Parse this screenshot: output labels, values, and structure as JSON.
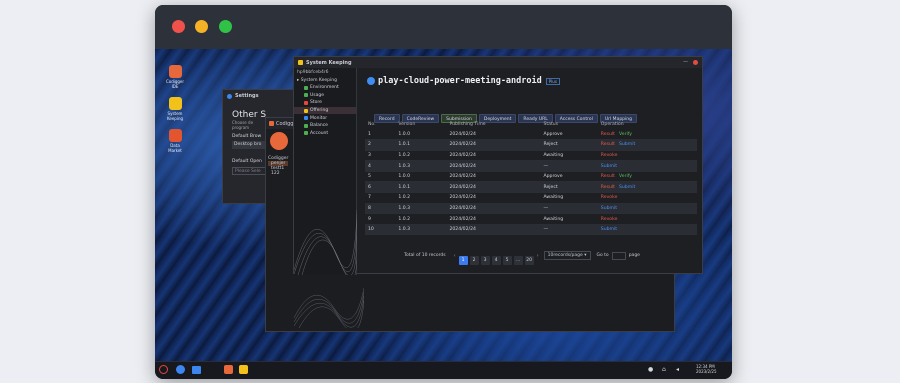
{
  "desktop": {
    "icons": [
      {
        "label": "Codigger IDE",
        "color": "#e7683a"
      },
      {
        "label": "System Keeping",
        "color": "#f3c21a"
      },
      {
        "label": "Data Market",
        "color": "#e2552f"
      }
    ]
  },
  "settings_window": {
    "title": "Settings",
    "heading": "Other S",
    "sub": "Choose de",
    "sub2": "program",
    "default_browser_label": "Default Brow",
    "browser_value": "Desktop bro",
    "default_open_label": "Default Open",
    "open_placeholder": "Please Sele"
  },
  "ide_window": {
    "title": "Codigg",
    "tree": [
      "Codigger",
      "penjer",
      "testt1",
      "122"
    ]
  },
  "system_keeping": {
    "title": "System Keeping",
    "user": "hp9bbfceb4r6",
    "root": "System Keeping",
    "menu": [
      "Environment",
      "Usage",
      "Store",
      "Offering",
      "Monitor",
      "Balance",
      "Account"
    ],
    "selected": "Offering"
  },
  "project": {
    "name": "play-cloud-power-meeting-android",
    "badge": "Plus",
    "tabs": [
      "Record",
      "CodeReview",
      "Submission",
      "Deployment",
      "Ready URL",
      "Access Control",
      "Url Mapping"
    ],
    "active_tab": "Submission"
  },
  "table": {
    "headers": [
      "No.",
      "Version",
      "Publishing Time",
      "Status",
      "Operation"
    ],
    "rows": [
      {
        "no": "1",
        "version": "1.0.0",
        "time": "2024/02/24",
        "status": "Approve",
        "ops": [
          {
            "t": "Result",
            "c": "r"
          },
          {
            "t": "Verify",
            "c": "g"
          }
        ]
      },
      {
        "no": "2",
        "version": "1.0.1",
        "time": "2024/02/24",
        "status": "Reject",
        "ops": [
          {
            "t": "Result",
            "c": "r"
          },
          {
            "t": "Submit",
            "c": "b"
          }
        ]
      },
      {
        "no": "3",
        "version": "1.0.2",
        "time": "2024/02/24",
        "status": "Awaiting",
        "ops": [
          {
            "t": "Revoke",
            "c": "r"
          }
        ]
      },
      {
        "no": "4",
        "version": "1.0.3",
        "time": "2024/02/24",
        "status": "—",
        "ops": [
          {
            "t": "Submit",
            "c": "b"
          }
        ]
      },
      {
        "no": "5",
        "version": "1.0.0",
        "time": "2024/02/24",
        "status": "Approve",
        "ops": [
          {
            "t": "Result",
            "c": "r"
          },
          {
            "t": "Verify",
            "c": "g"
          }
        ]
      },
      {
        "no": "6",
        "version": "1.0.1",
        "time": "2024/02/24",
        "status": "Reject",
        "ops": [
          {
            "t": "Result",
            "c": "r"
          },
          {
            "t": "Submit",
            "c": "b"
          }
        ]
      },
      {
        "no": "7",
        "version": "1.0.2",
        "time": "2024/02/24",
        "status": "Awaiting",
        "ops": [
          {
            "t": "Revoke",
            "c": "r"
          }
        ]
      },
      {
        "no": "8",
        "version": "1.0.3",
        "time": "2024/02/24",
        "status": "—",
        "ops": [
          {
            "t": "Submit",
            "c": "b"
          }
        ]
      },
      {
        "no": "9",
        "version": "1.0.2",
        "time": "2024/02/24",
        "status": "Awaiting",
        "ops": [
          {
            "t": "Revoke",
            "c": "r"
          }
        ]
      },
      {
        "no": "10",
        "version": "1.0.3",
        "time": "2024/02/24",
        "status": "—",
        "ops": [
          {
            "t": "Submit",
            "c": "b"
          }
        ]
      }
    ]
  },
  "pagination": {
    "total": "Total of 10 records",
    "pages": [
      "1",
      "2",
      "3",
      "4",
      "5",
      "...",
      "20"
    ],
    "current": "1",
    "per_page": "10records/page",
    "goto_label": "Go to",
    "page_label": "page"
  },
  "taskbar": {
    "time": "12:34",
    "ampm": "PM",
    "date": "2023/2/25"
  }
}
